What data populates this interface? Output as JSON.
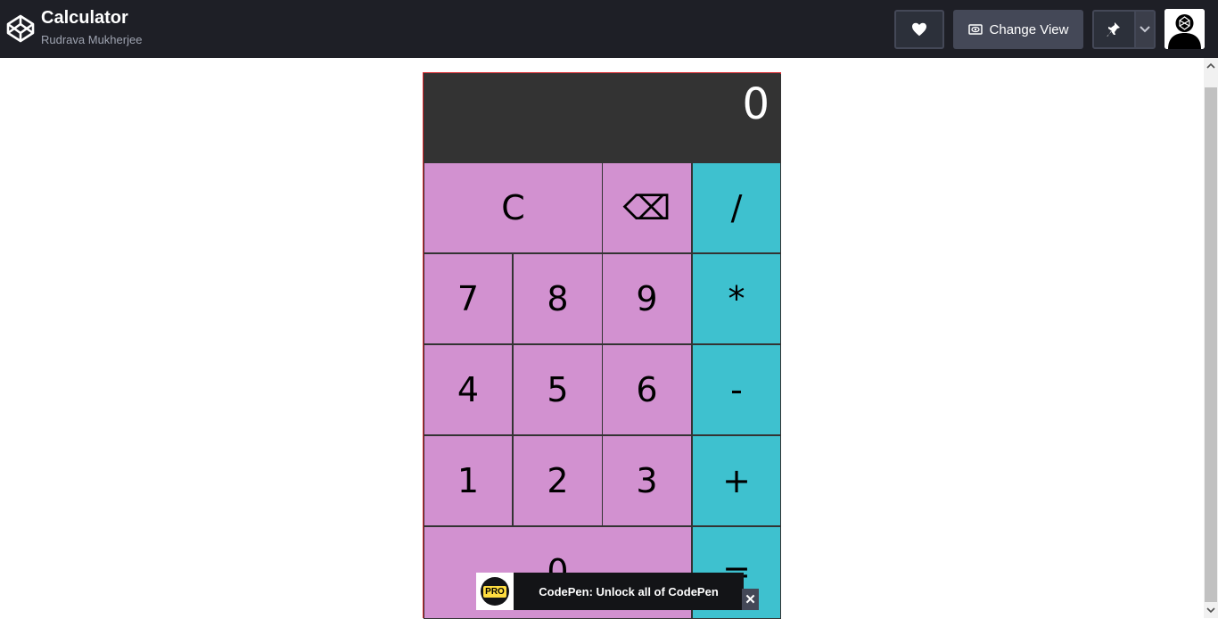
{
  "header": {
    "title": "Calculator",
    "author": "Rudrava Mukherjee",
    "change_view_label": "Change View"
  },
  "icons": {
    "logo": "codepen-logo-icon",
    "heart": "heart-icon",
    "change_view": "eye-icon",
    "pin": "pin-icon",
    "dropdown": "chevron-down-icon",
    "avatar": "user-avatar-icon",
    "close": "close-icon"
  },
  "calculator": {
    "display": "0",
    "keys": {
      "clear": "C",
      "backspace": "⌫",
      "divide": "/",
      "seven": "7",
      "eight": "8",
      "nine": "9",
      "multiply": "*",
      "four": "4",
      "five": "5",
      "six": "6",
      "subtract": "-",
      "one": "1",
      "two": "2",
      "three": "3",
      "add": "+",
      "zero": "0",
      "equals": "="
    }
  },
  "promo": {
    "badge": "PRO",
    "text": "CodePen: Unlock all of CodePen",
    "close": "✕"
  },
  "colors": {
    "topbar": "#1e1f26",
    "number_key": "#d291d0",
    "operator_key": "#3ec1cf",
    "display_bg": "#333333"
  }
}
